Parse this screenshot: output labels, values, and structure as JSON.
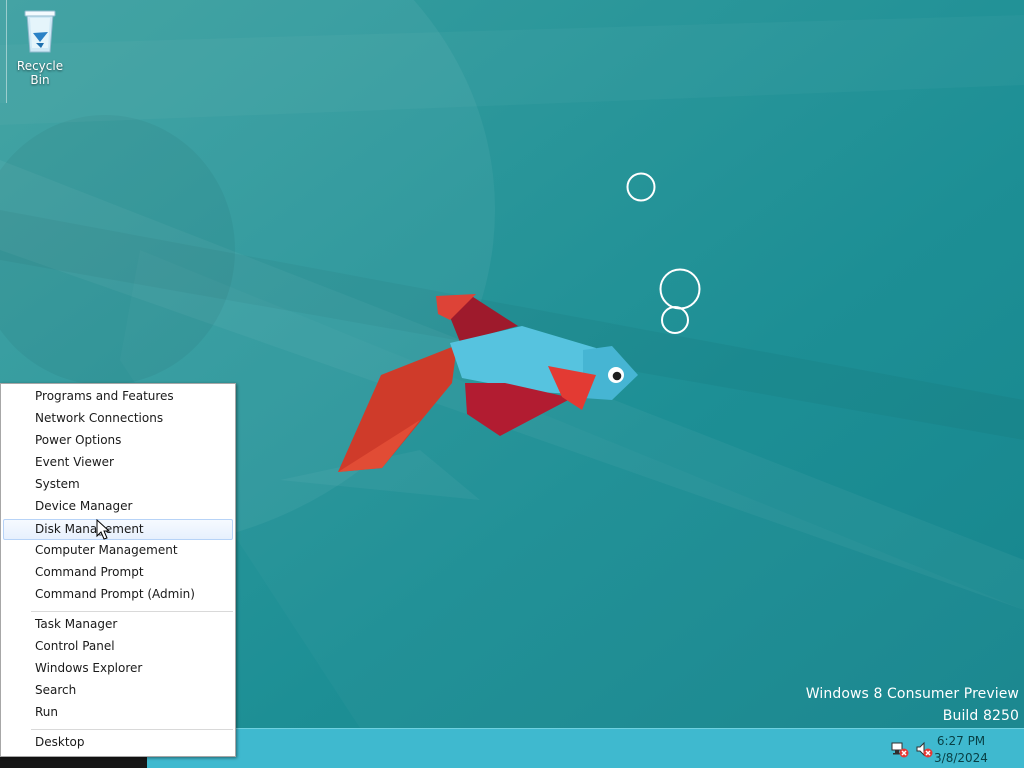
{
  "desktop": {
    "background_color": "#1f8f94",
    "icons": [
      {
        "label": "Recycle Bin",
        "icon": "recycle-bin-icon"
      }
    ],
    "wallpaper": "betta-fish"
  },
  "watermark": {
    "line1": "Windows 8 Consumer Preview",
    "line2": "Build 8250"
  },
  "taskbar": {
    "color": "#3fb9cf",
    "clock": {
      "time": "6:27 PM",
      "date": "3/8/2024"
    },
    "tray_icons": [
      "network-error-icon",
      "volume-muted-icon"
    ]
  },
  "winx_menu": {
    "hovered_item": "Disk Management",
    "groups": [
      [
        "Programs and Features",
        "Network Connections",
        "Power Options",
        "Event Viewer",
        "System",
        "Device Manager",
        "Disk Management",
        "Computer Management",
        "Command Prompt",
        "Command Prompt (Admin)"
      ],
      [
        "Task Manager",
        "Control Panel",
        "Windows Explorer",
        "Search",
        "Run"
      ],
      [
        "Desktop"
      ]
    ]
  }
}
